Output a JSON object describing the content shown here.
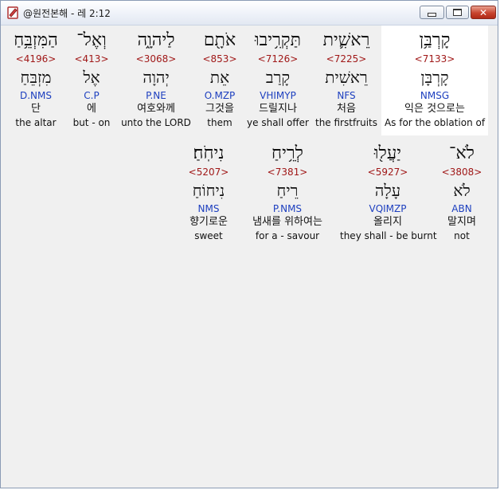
{
  "window": {
    "title": "@원전본해 - 레 2:12",
    "min_label": "",
    "max_label": "",
    "close_label": "✕"
  },
  "rows": [
    {
      "words": [
        {
          "heb": "קָרְבַּ֥ן",
          "strong": "<7133>",
          "lex": "קָרְבָּן",
          "morph": "NMSG",
          "kor": "익은 것으로는",
          "eng": "As for the oblation of"
        },
        {
          "heb": "רֵאשִׁ֛ית",
          "strong": "<7225>",
          "lex": "רֵאשִׁית",
          "morph": "NFS",
          "kor": "처음",
          "eng": "the firstfruits"
        },
        {
          "heb": "תַּקְרִ֥יבוּ",
          "strong": "<7126>",
          "lex": "קָרַב",
          "morph": "VHIMYP",
          "kor": "드릴지나",
          "eng": "ye shall offer"
        },
        {
          "heb": "אֹתָ֖ם",
          "strong": "<853>",
          "lex": "אֵת",
          "morph": "O.MZP",
          "kor": "그것을",
          "eng": "them"
        },
        {
          "heb": "לַיהוָ֑ה",
          "strong": "<3068>",
          "lex": "יְהוָה",
          "morph": "P.NE",
          "kor": "여호와께",
          "eng": "unto the LORD"
        },
        {
          "heb": "וְאֶל־",
          "strong": "<413>",
          "lex": "אֶל",
          "morph": "C.P",
          "kor": "에",
          "eng": "but - on"
        },
        {
          "heb": "הַמִּזְבֵּ֥חַ",
          "strong": "<4196>",
          "lex": "מִזְבֵּחַ",
          "morph": "D.NMS",
          "kor": "단",
          "eng": "the altar"
        }
      ]
    },
    {
      "words": [
        {
          "heb": "לֹא־",
          "strong": "<3808>",
          "lex": "לֹא",
          "morph": "ABN",
          "kor": "말지며",
          "eng": "not"
        },
        {
          "heb": "יַעֲל֖וּ",
          "strong": "<5927>",
          "lex": "עָלָה",
          "morph": "VQIMZP",
          "kor": "올리지",
          "eng": "they shall - be burnt"
        },
        {
          "heb": "לְרֵ֥יחַ",
          "strong": "<7381>",
          "lex": "רֵיחַ",
          "morph": "P.NMS",
          "kor": "냄새를 위하여는",
          "eng": "for a - savour"
        },
        {
          "heb": "נִיחֹֽחַ׃",
          "strong": "<5207>",
          "lex": "נִיחוֹחַ",
          "morph": "NMS",
          "kor": "향기로운",
          "eng": "sweet"
        }
      ]
    }
  ]
}
